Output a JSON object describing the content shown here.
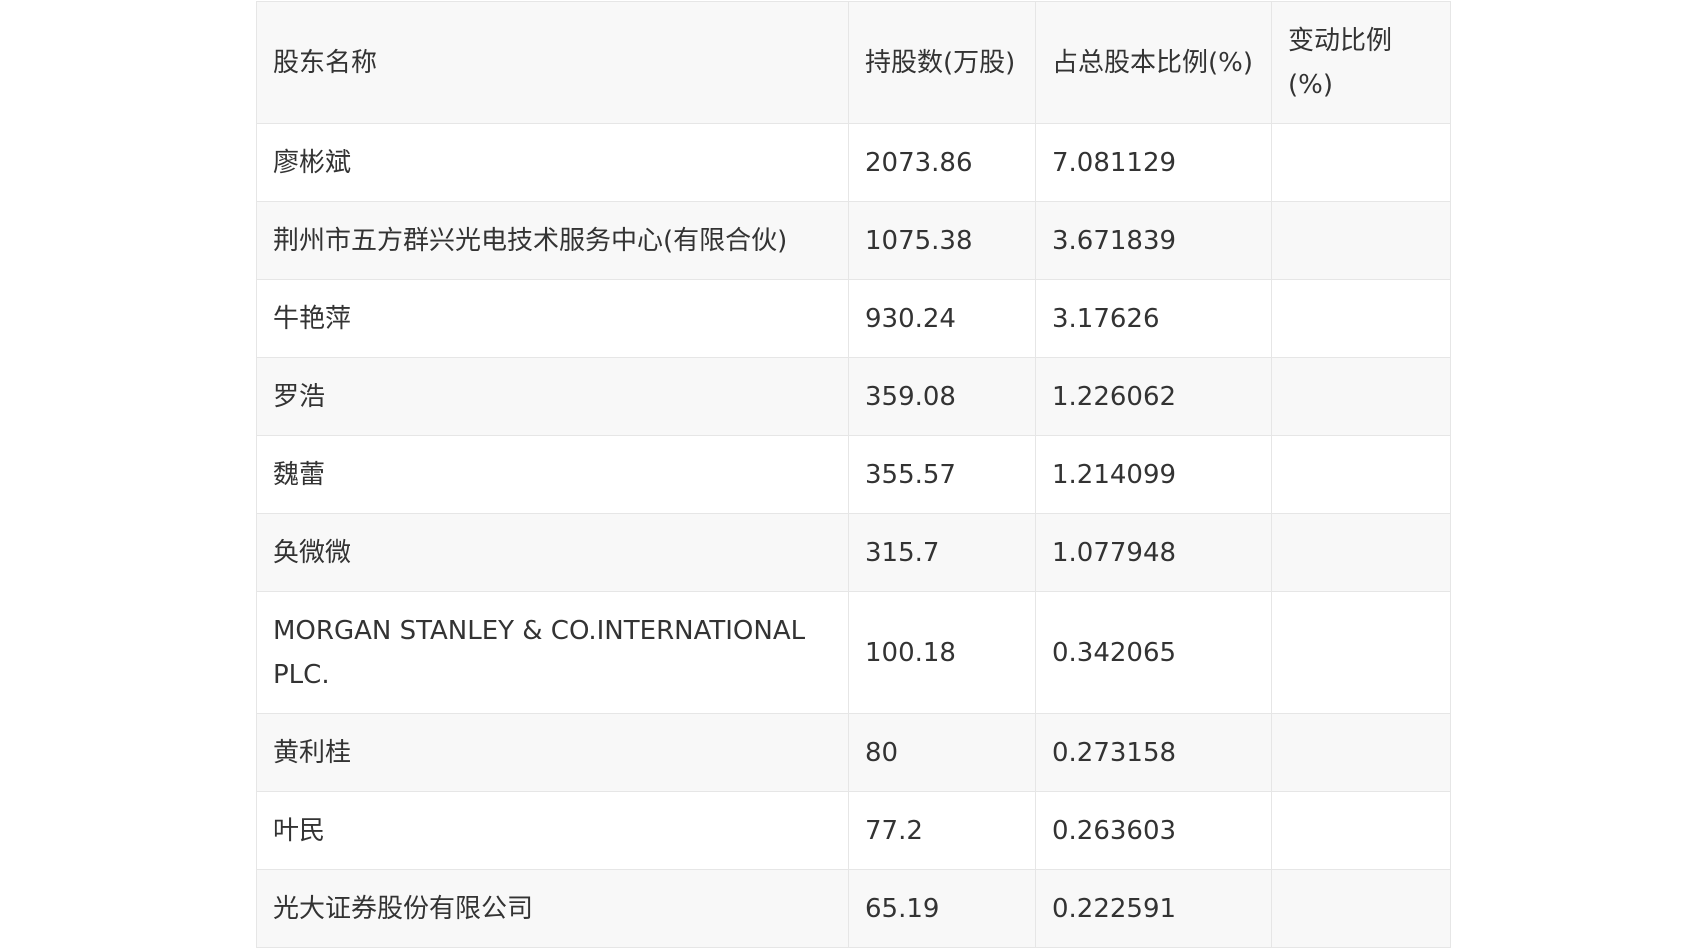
{
  "table": {
    "headers": [
      "股东名称",
      "持股数(万股)",
      "占总股本比例(%)",
      "变动比例(%)"
    ],
    "rows": [
      [
        "廖彬斌",
        "2073.86",
        "7.081129",
        ""
      ],
      [
        "荆州市五方群兴光电技术服务中心(有限合伙)",
        "1075.38",
        "3.671839",
        ""
      ],
      [
        "牛艳萍",
        "930.24",
        "3.17626",
        ""
      ],
      [
        "罗浩",
        "359.08",
        "1.226062",
        ""
      ],
      [
        "魏蕾",
        "355.57",
        "1.214099",
        ""
      ],
      [
        "奂微微",
        "315.7",
        "1.077948",
        ""
      ],
      [
        "MORGAN STANLEY & CO.INTERNATIONAL PLC.",
        "100.18",
        "0.342065",
        ""
      ],
      [
        "黄利桂",
        "80",
        "0.273158",
        ""
      ],
      [
        "叶民",
        "77.2",
        "0.263603",
        ""
      ],
      [
        "光大证券股份有限公司",
        "65.19",
        "0.222591",
        ""
      ]
    ]
  }
}
